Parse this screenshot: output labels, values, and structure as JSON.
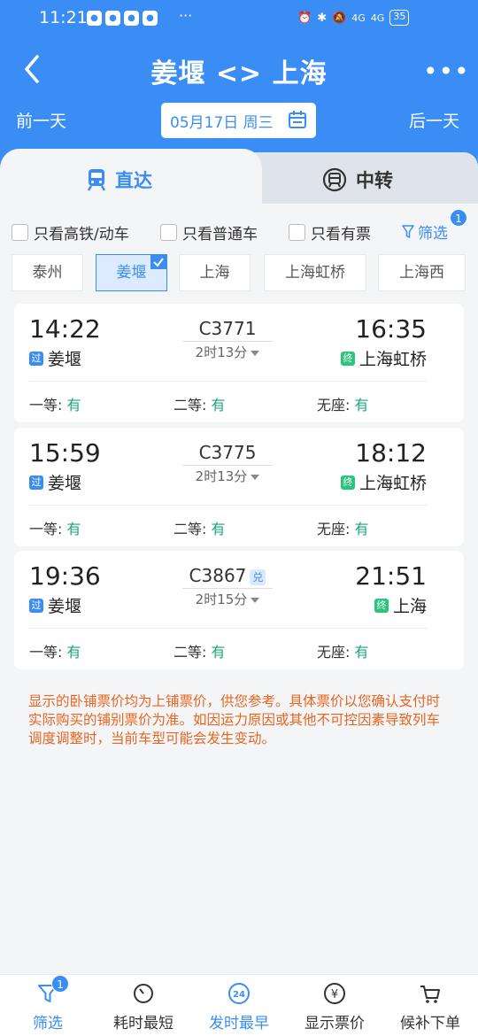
{
  "status_bar": {
    "time": "11:21",
    "battery": "35",
    "signal_1": "4G",
    "signal_2": "4G"
  },
  "nav": {
    "title": "姜堰 <> 上海"
  },
  "date_bar": {
    "prev": "前一天",
    "date": "05月17日 周三",
    "next": "后一天"
  },
  "tabs": [
    {
      "label": "直达"
    },
    {
      "label": "中转"
    }
  ],
  "filters": {
    "options": [
      "只看高铁/动车",
      "只看普通车",
      "只看有票"
    ],
    "filter_label": "筛选",
    "filter_badge": "1"
  },
  "stations": [
    "泰州",
    "姜堰",
    "上海",
    "上海虹桥",
    "上海西"
  ],
  "trains": [
    {
      "dep_time": "14:22",
      "dep_tag": "过",
      "dep_station": "姜堰",
      "code": "C3771",
      "duration": "2时13分",
      "arr_time": "16:35",
      "arr_tag": "终",
      "arr_station": "上海虹桥",
      "seats": [
        {
          "label": "一等:",
          "value": "有"
        },
        {
          "label": "二等:",
          "value": "有"
        },
        {
          "label": "无座:",
          "value": "有"
        }
      ]
    },
    {
      "dep_time": "15:59",
      "dep_tag": "过",
      "dep_station": "姜堰",
      "code": "C3775",
      "duration": "2时13分",
      "arr_time": "18:12",
      "arr_tag": "终",
      "arr_station": "上海虹桥",
      "seats": [
        {
          "label": "一等:",
          "value": "有"
        },
        {
          "label": "二等:",
          "value": "有"
        },
        {
          "label": "无座:",
          "value": "有"
        }
      ]
    },
    {
      "dep_time": "19:36",
      "dep_tag": "过",
      "dep_station": "姜堰",
      "code": "C3867",
      "code_badge": "兑",
      "duration": "2时15分",
      "arr_time": "21:51",
      "arr_tag": "终",
      "arr_station": "上海",
      "seats": [
        {
          "label": "一等:",
          "value": "有"
        },
        {
          "label": "二等:",
          "value": "有"
        },
        {
          "label": "无座:",
          "value": "有"
        }
      ]
    }
  ],
  "notice": "显示的卧铺票价均为上铺票价，供您参考。具体票价以您确认支付时实际购买的铺别票价为准。如因运力原因或其他不可控因素导致列车调度调整时，当前车型可能会发生变动。",
  "bottom_bar": [
    {
      "label": "筛选",
      "badge": "1"
    },
    {
      "label": "耗时最短"
    },
    {
      "label": "发时最早",
      "icon_text": "24"
    },
    {
      "label": "显示票价",
      "icon_text": "¥"
    },
    {
      "label": "候补下单"
    }
  ],
  "colors": {
    "primary": "#3a8df4",
    "available": "#1aa67a",
    "notice": "#e9651f",
    "terminal_tag": "#29c57a"
  }
}
